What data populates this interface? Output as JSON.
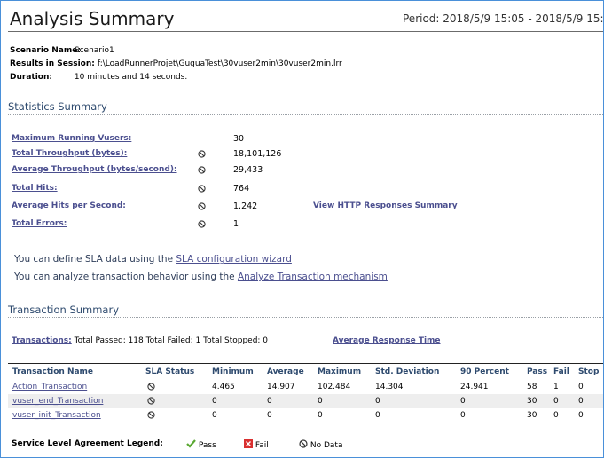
{
  "header": {
    "title": "Analysis Summary",
    "period": "Period: 2018/5/9 15:05 - 2018/5/9 15:15"
  },
  "scenario": {
    "name_label": "Scenario Name:",
    "name_value": "Scenario1",
    "results_label": "Results in Session:",
    "results_value": "f:\\LoadRunnerProjet\\GuguaTest\\30vuser2min\\30vuser2min.lrr",
    "duration_label": "Duration:",
    "duration_value": "10 minutes and 14 seconds."
  },
  "statistics": {
    "heading": "Statistics Summary",
    "rows": [
      {
        "label": "Maximum Running Vusers:",
        "value": "30",
        "icon": false
      },
      {
        "label": "Total Throughput (bytes):",
        "value": "18,101,126",
        "icon": true
      },
      {
        "label": "Average Throughput (bytes/second):",
        "value": "29,433",
        "icon": true
      },
      {
        "label": "Total Hits:",
        "value": "764",
        "icon": true
      },
      {
        "label": "Average Hits per Second:",
        "value": "1.242",
        "icon": true
      },
      {
        "label": "Total Errors:",
        "value": "1",
        "icon": true
      }
    ],
    "http_link": "View HTTP Responses Summary"
  },
  "sla": {
    "line1_prefix": "You can define SLA data using the ",
    "line1_link": "SLA configuration wizard",
    "line2_prefix": "You can analyze transaction behavior using the ",
    "line2_link": "Analyze Transaction mechanism"
  },
  "transactions": {
    "heading": "Transaction Summary",
    "summary_link": "Transactions:",
    "summary_text": " Total Passed: 118 Total Failed: 1 Total Stopped: 0",
    "avg_response_link": "Average Response Time",
    "columns": [
      "Transaction Name",
      "SLA Status",
      "Minimum",
      "Average",
      "Maximum",
      "Std. Deviation",
      "90 Percent",
      "Pass",
      "Fail",
      "Stop"
    ],
    "rows": [
      {
        "name": "Action_Transaction",
        "minimum": "4.465",
        "average": "14.907",
        "maximum": "102.484",
        "std": "14.304",
        "p90": "24.941",
        "pass": "58",
        "fail": "1",
        "stop": "0"
      },
      {
        "name": "vuser_end_Transaction",
        "minimum": "0",
        "average": "0",
        "maximum": "0",
        "std": "0",
        "p90": "0",
        "pass": "30",
        "fail": "0",
        "stop": "0"
      },
      {
        "name": "vuser_init_Transaction",
        "minimum": "0",
        "average": "0",
        "maximum": "0",
        "std": "0",
        "p90": "0",
        "pass": "30",
        "fail": "0",
        "stop": "0"
      }
    ]
  },
  "legend": {
    "title": "Service Level Agreement Legend:",
    "pass": "Pass",
    "fail": "Fail",
    "nodata": "No Data"
  },
  "colors": {
    "link": "#4b4f8f",
    "heading": "#2e4a6e",
    "pass_icon": "#5aa832",
    "fail_icon": "#d93030"
  }
}
